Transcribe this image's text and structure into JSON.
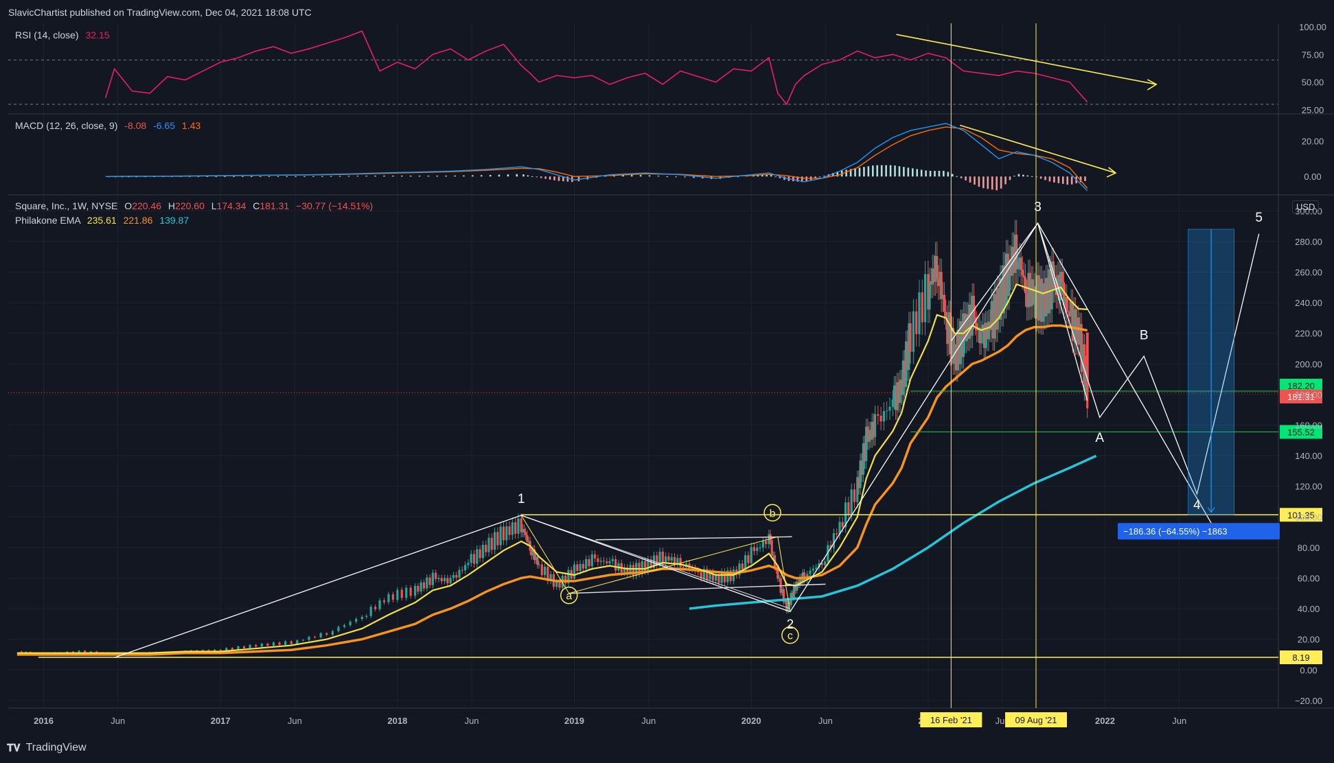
{
  "header": {
    "published": "SlavicChartist published on TradingView.com, Dec 04, 2021 18:08 UTC"
  },
  "footer": {
    "brand": "TradingView"
  },
  "colors": {
    "bg": "#131722",
    "grid": "#1e2230",
    "axis": "#363a45",
    "up": "#26a69a",
    "down": "#ef5350",
    "ema1": "#f5e146",
    "ema2": "#f7931e",
    "ema3": "#26c6da",
    "rsi": "#e91e63",
    "macd": "#2196f3",
    "signal": "#ff6d00",
    "annot": "#ffee58",
    "wave": "#ffffff"
  },
  "chart_data": [
    {
      "type": "line",
      "title": "RSI (14, close)",
      "last_value": "32.15",
      "ylim": [
        25,
        100
      ],
      "y_ticks": [
        "100.00",
        "75.00",
        "50.00",
        "25.00"
      ],
      "bands": [
        70,
        30
      ],
      "x": [
        2016.35,
        2016.4,
        2016.5,
        2016.6,
        2016.7,
        2016.8,
        2016.9,
        2017.0,
        2017.1,
        2017.2,
        2017.3,
        2017.4,
        2017.5,
        2017.6,
        2017.7,
        2017.8,
        2017.9,
        2018.0,
        2018.1,
        2018.2,
        2018.3,
        2018.4,
        2018.5,
        2018.6,
        2018.7,
        2018.75,
        2018.8,
        2018.9,
        2019.0,
        2019.1,
        2019.2,
        2019.3,
        2019.4,
        2019.5,
        2019.6,
        2019.7,
        2019.8,
        2019.9,
        2020.0,
        2020.1,
        2020.15,
        2020.2,
        2020.25,
        2020.3,
        2020.4,
        2020.5,
        2020.6,
        2020.7,
        2020.8,
        2020.9,
        2021.0,
        2021.1,
        2021.2,
        2021.3,
        2021.4,
        2021.5,
        2021.6,
        2021.7,
        2021.8,
        2021.9
      ],
      "series": [
        {
          "values": [
            36,
            62,
            42,
            40,
            55,
            52,
            60,
            68,
            72,
            78,
            82,
            76,
            80,
            85,
            90,
            96,
            60,
            68,
            62,
            75,
            80,
            70,
            78,
            84,
            65,
            58,
            50,
            56,
            54,
            56,
            48,
            54,
            58,
            48,
            60,
            55,
            50,
            62,
            60,
            72,
            40,
            30,
            48,
            56,
            66,
            70,
            78,
            72,
            75,
            70,
            76,
            72,
            60,
            58,
            56,
            60,
            58,
            54,
            50,
            32
          ]
        }
      ]
    },
    {
      "type": "line",
      "title": "MACD (12, 26, close, 9)",
      "values_label": [
        "-8.08",
        "-6.65",
        "1.43"
      ],
      "ylim": [
        -10,
        35
      ],
      "y_ticks": [
        "20.00",
        "0.00"
      ],
      "x": [
        2016.35,
        2016.5,
        2016.7,
        2016.9,
        2017.1,
        2017.3,
        2017.5,
        2017.7,
        2017.9,
        2018.1,
        2018.3,
        2018.5,
        2018.7,
        2018.8,
        2018.9,
        2019.0,
        2019.2,
        2019.4,
        2019.6,
        2019.8,
        2020.0,
        2020.1,
        2020.2,
        2020.3,
        2020.4,
        2020.5,
        2020.6,
        2020.7,
        2020.8,
        2020.9,
        2021.0,
        2021.1,
        2021.2,
        2021.3,
        2021.4,
        2021.5,
        2021.6,
        2021.7,
        2021.8,
        2021.9
      ],
      "series": [
        {
          "values": [
            0,
            0.1,
            0.2,
            0.4,
            0.6,
            0.8,
            1,
            1.4,
            2,
            2.5,
            3,
            4,
            5.5,
            4,
            1,
            -2,
            1,
            2,
            1,
            -1,
            1,
            2,
            -1,
            -3,
            -1,
            3,
            8,
            16,
            22,
            26,
            28,
            30,
            26,
            18,
            10,
            14,
            12,
            8,
            2,
            -8.08
          ]
        },
        {
          "values": [
            0,
            0.1,
            0.1,
            0.3,
            0.5,
            0.7,
            0.9,
            1.2,
            1.7,
            2.2,
            2.7,
            3.5,
            4.6,
            4.4,
            2.5,
            0,
            0.5,
            1.5,
            1.2,
            0,
            0.5,
            1.2,
            0.5,
            -1,
            -1,
            1,
            5,
            12,
            18,
            23,
            26,
            28,
            27,
            22,
            15,
            13,
            12,
            10,
            5,
            -6.65
          ]
        }
      ]
    },
    {
      "type": "candlestick",
      "title": "Square, Inc., 1W, NYSE",
      "ohlc_label": {
        "o_label": "O",
        "o": "220.46",
        "h_label": "H",
        "h": "220.60",
        "l_label": "L",
        "l": "174.34",
        "c_label": "C",
        "c": "181.31",
        "chg": "−30.77 (−14.51%)"
      },
      "ema_label": {
        "name": "Philakone EMA",
        "v1": "235.61",
        "v2": "221.86",
        "v3": "139.87"
      },
      "currency": "USD",
      "ylim": [
        -25,
        310
      ],
      "y_ticks": [
        "300.00",
        "280.00",
        "260.00",
        "240.00",
        "220.00",
        "200.00",
        "180.00",
        "160.00",
        "140.00",
        "120.00",
        "100.00",
        "80.00",
        "60.00",
        "40.00",
        "20.00",
        "0.00",
        "−20.00"
      ],
      "x_ticks": [
        "2016",
        "Jun",
        "2017",
        "Jun",
        "2018",
        "Jun",
        "2019",
        "Jun",
        "2020",
        "Jun",
        "2021",
        "Jun",
        "2022",
        "Jun"
      ],
      "x": [
        2015.85,
        2016.0,
        2016.2,
        2016.4,
        2016.6,
        2016.8,
        2017.0,
        2017.2,
        2017.4,
        2017.6,
        2017.8,
        2017.95,
        2018.1,
        2018.2,
        2018.3,
        2018.4,
        2018.5,
        2018.6,
        2018.7,
        2018.75,
        2018.8,
        2018.9,
        2019.0,
        2019.1,
        2019.2,
        2019.3,
        2019.4,
        2019.5,
        2019.6,
        2019.7,
        2019.8,
        2019.9,
        2020.0,
        2020.1,
        2020.15,
        2020.2,
        2020.25,
        2020.3,
        2020.4,
        2020.5,
        2020.6,
        2020.65,
        2020.7,
        2020.8,
        2020.85,
        2020.9,
        2021.0,
        2021.05,
        2021.1,
        2021.15,
        2021.2,
        2021.25,
        2021.3,
        2021.35,
        2021.4,
        2021.45,
        2021.5,
        2021.55,
        2021.6,
        2021.65,
        2021.7,
        2021.75,
        2021.8,
        2021.85,
        2021.9
      ],
      "close": [
        12,
        10,
        12,
        10,
        11,
        12,
        13,
        16,
        18,
        24,
        35,
        48,
        52,
        60,
        58,
        70,
        80,
        90,
        95,
        80,
        68,
        55,
        65,
        72,
        70,
        64,
        68,
        74,
        70,
        64,
        60,
        62,
        76,
        86,
        60,
        40,
        55,
        62,
        70,
        95,
        120,
        150,
        160,
        175,
        185,
        220,
        250,
        265,
        230,
        205,
        220,
        232,
        215,
        225,
        240,
        260,
        275,
        250,
        245,
        240,
        252,
        250,
        230,
        220,
        181.31
      ],
      "ema1": [
        11,
        11,
        11,
        11,
        11,
        12,
        12,
        14,
        16,
        20,
        27,
        36,
        44,
        52,
        55,
        62,
        70,
        78,
        84,
        81,
        74,
        64,
        62,
        66,
        68,
        66,
        66,
        70,
        69,
        66,
        62,
        62,
        68,
        76,
        68,
        56,
        55,
        58,
        64,
        80,
        100,
        125,
        140,
        156,
        168,
        190,
        215,
        232,
        230,
        220,
        220,
        225,
        222,
        224,
        230,
        240,
        252,
        250,
        248,
        246,
        248,
        250,
        242,
        236,
        235.61
      ],
      "ema2": [
        10,
        10,
        10,
        10,
        10,
        11,
        11,
        12,
        13,
        16,
        20,
        25,
        30,
        36,
        40,
        45,
        51,
        56,
        60,
        61,
        60,
        58,
        58,
        60,
        62,
        63,
        64,
        66,
        66,
        65,
        64,
        63,
        65,
        68,
        66,
        62,
        60,
        60,
        62,
        68,
        80,
        95,
        108,
        122,
        132,
        148,
        165,
        178,
        185,
        190,
        195,
        200,
        202,
        205,
        208,
        212,
        218,
        222,
        224,
        224,
        225,
        225,
        224,
        223,
        221.86
      ],
      "ema3_x": [
        2019.65,
        2019.8,
        2020.0,
        2020.2,
        2020.4,
        2020.6,
        2020.8,
        2021.0,
        2021.2,
        2021.4,
        2021.6,
        2021.8,
        2021.95
      ],
      "ema3": [
        40,
        42,
        44,
        46,
        48,
        55,
        66,
        80,
        96,
        110,
        122,
        132,
        139.87
      ],
      "price_tags": [
        {
          "label": "182.20",
          "value": 182.2,
          "color": "#00e676"
        },
        {
          "label": "181.31",
          "value": 181.31,
          "color": "#ef5350"
        },
        {
          "label": "155.52",
          "value": 155.52,
          "color": "#00e676"
        },
        {
          "label": "101.35",
          "value": 101.35,
          "color": "#ffee58"
        },
        {
          "label": "8.19",
          "value": 8.19,
          "color": "#ffee58"
        }
      ],
      "annotations": {
        "wave_labels": [
          {
            "text": "1",
            "x": 2018.7,
            "y": 109
          },
          {
            "text": "2",
            "x": 2020.22,
            "y": 27
          },
          {
            "text": "3",
            "x": 2021.62,
            "y": 300
          },
          {
            "text": "A",
            "x": 2021.97,
            "y": 149
          },
          {
            "text": "B",
            "x": 2022.22,
            "y": 216
          },
          {
            "text": "4",
            "x": 2022.52,
            "y": 105
          },
          {
            "text": "5",
            "x": 2022.87,
            "y": 293
          }
        ],
        "corrective_labels": [
          {
            "text": "a",
            "x": 2018.97,
            "y": 46
          },
          {
            "text": "b",
            "x": 2020.12,
            "y": 100
          },
          {
            "text": "c",
            "x": 2020.22,
            "y": 20
          }
        ],
        "date_tags": [
          {
            "text": "16 Feb '21",
            "x": 2021.13
          },
          {
            "text": "09 Aug '21",
            "x": 2021.61
          }
        ],
        "measure_label": "−186.36 (−64.55%) −1863",
        "wave_path": [
          [
            2016.4,
            8
          ],
          [
            2018.7,
            101
          ],
          [
            2020.22,
            38
          ],
          [
            2021.62,
            292
          ],
          [
            2021.97,
            165
          ],
          [
            2022.22,
            205
          ],
          [
            2022.52,
            115
          ],
          [
            2022.87,
            285
          ]
        ],
        "alt_path": [
          [
            2021.62,
            292
          ],
          [
            2022.6,
            96
          ]
        ]
      }
    }
  ]
}
